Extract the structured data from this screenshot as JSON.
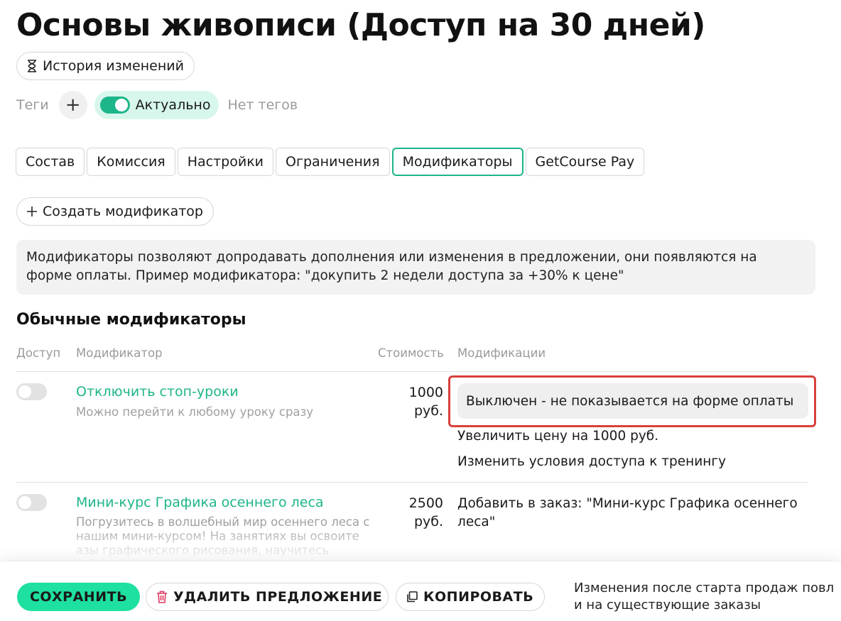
{
  "page": {
    "title": "Основы живописи (Доступ на 30 дней)",
    "history_label": "История изменений"
  },
  "tags": {
    "label": "Теги",
    "plus": "+",
    "actual_label": "Актуально",
    "actual_on": true,
    "no_tags": "Нет тегов"
  },
  "tabs": [
    {
      "label": "Состав",
      "active": false
    },
    {
      "label": "Комиссия",
      "active": false
    },
    {
      "label": "Настройки",
      "active": false
    },
    {
      "label": "Ограничения",
      "active": false
    },
    {
      "label": "Модификаторы",
      "active": true
    },
    {
      "label": "GetCourse Pay",
      "active": false
    }
  ],
  "create_button": "Создать модификатор",
  "info_text": "Модификаторы позволяют допродавать дополнения или изменения в предложении, они появляются на форме оплаты. Пример модификатора: \"докупить 2 недели доступа за +30% к цене\"",
  "section": {
    "title": "Обычные модификаторы",
    "headers": [
      "Доступ",
      "Модификатор",
      "Стоимость",
      "Модификации"
    ]
  },
  "rows": [
    {
      "enabled": false,
      "name": "Отключить стоп-уроки",
      "description": "Можно перейти к любому уроку сразу",
      "cost_line1": "1000",
      "cost_line2": "руб.",
      "status": "Выключен - не показывается на форме оплаты",
      "modifications": [
        "Увеличить цену на 1000 руб.",
        "Изменить условия доступа к тренингу"
      ]
    },
    {
      "enabled": false,
      "name": "Мини-курс Графика осеннего леса",
      "description": "Погрузитесь в волшебный мир осеннего леса с нашим мини-курсом! На занятиях вы освоите азы графического рисования, научитесь",
      "cost_line1": "2500",
      "cost_line2": "руб.",
      "modifications": [
        "Добавить в заказ: \"Мини-курс Графика осеннего",
        "леса\""
      ]
    }
  ],
  "footer": {
    "save": "СОХРАНИТЬ",
    "delete": "УДАЛИТЬ ПРЕДЛОЖЕНИЕ",
    "copy": "КОПИРОВАТЬ",
    "note_line1": "Изменения после старта продаж повл",
    "note_line2": "и на существующие заказы"
  },
  "colors": {
    "accent": "#1db58a",
    "save_bg": "#1ee0a0",
    "highlight": "#d9403a",
    "delete_icon": "#e0365f"
  },
  "icons": {
    "history": "hourglass-icon",
    "create": "plus-icon",
    "delete": "trash-icon",
    "copy": "copy-icon"
  }
}
